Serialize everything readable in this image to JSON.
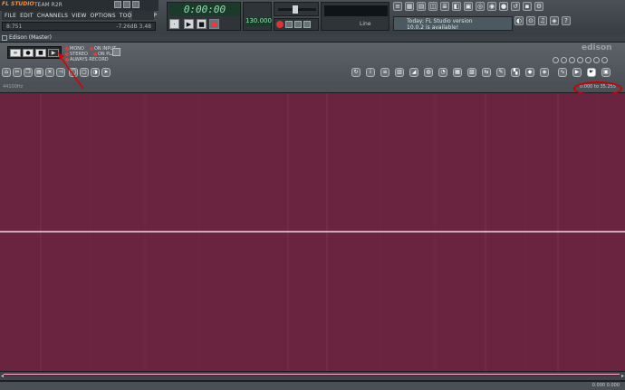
{
  "app": {
    "logo": "FL STUDIO",
    "registered_to": "TEAM R2R",
    "menu": [
      "FILE",
      "EDIT",
      "CHANNELS",
      "VIEW",
      "OPTIONS",
      "TOOLS",
      "HELP"
    ],
    "hint_left": "8:751",
    "hint_right": "-7.26dB  3.48",
    "time": "0:00:00",
    "tempo": "130.000",
    "monitor_label": "Line",
    "news_line1": "Today: FL Studio version",
    "news_line2": "10.0.2 is available!"
  },
  "edison": {
    "window_title": "Edison (Master)",
    "mode_buttons": [
      "∞",
      "●",
      "■",
      "▶"
    ],
    "options": [
      "MONO",
      "ON INPUT",
      "STEREO",
      "ON PLAY",
      "ALWAYS RECORD"
    ],
    "logo": "edison",
    "sample_rate": "44100Hz",
    "selection_info": "0:000 to 35.255"
  },
  "status": {
    "left": "",
    "right": "0.000 0.000"
  },
  "colors": {
    "waveform_bg": "#6a2440",
    "waveform_line": "#f0d8e0",
    "annotation": "#cc0000"
  }
}
